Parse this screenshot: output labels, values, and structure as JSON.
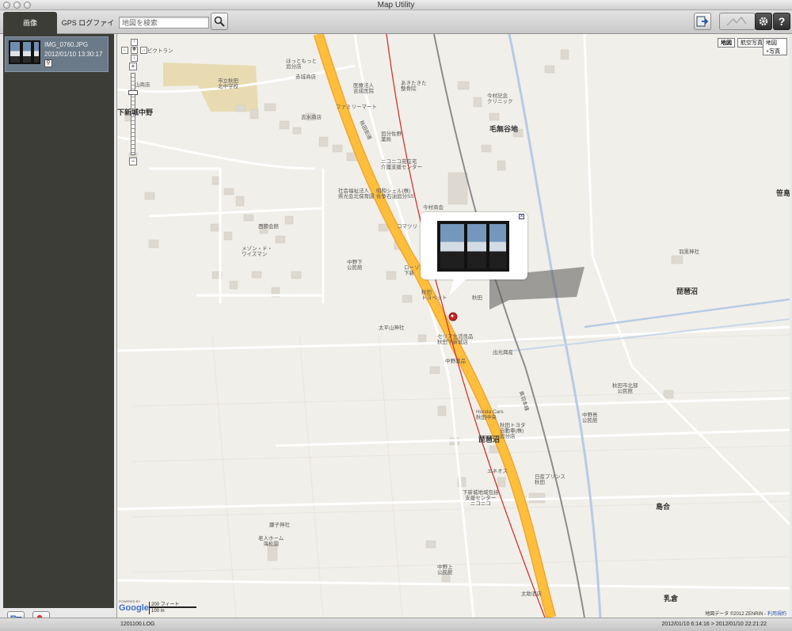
{
  "window": {
    "title": "Map Utility"
  },
  "tabs": {
    "images": "画像",
    "gps_log": "GPS ログファイル"
  },
  "search": {
    "placeholder": "地図を検索"
  },
  "sidebar": {
    "items": [
      {
        "filename": "IMG_0760.JPG",
        "datetime": "2012/01/10 13:30:17"
      }
    ]
  },
  "map": {
    "type_buttons": [
      "地図",
      "航空写真",
      "地図+写真"
    ],
    "labels": {
      "shokudo": "ビクトラン",
      "konan": "山商店",
      "school": "市立秋田\n北中学校",
      "hottomotto": "ほっともっと\n追分店",
      "akagi": "赤城商店",
      "iryou": "医療法人\n吉成医院",
      "akita_seikei": "あきたきた\n整骨院",
      "imamura": "今村記念\nクリニック",
      "familymart": "ファミリーマート",
      "yoshimizu": "吉水商店",
      "oiwake_yakkyoku": "追分佐野\n薬局",
      "nikoniko": "ニコニコ苑在宅\n介護支援センター",
      "shakai": "社会福祉法人\n県光会北保育園",
      "showa_shell": "昭和シェル(株)\n佐争石油追分SS",
      "komatsu": "コマツリ",
      "imaya": "今村商会",
      "nishiaikai": "西節会館",
      "mason": "メゾン・ド・\nワイズマン",
      "nakano_park": "中野下\n公民館",
      "lawson": "ローソン\n下新",
      "trolley": "秋田\nトヨペット",
      "akita_bank": "秋田",
      "taiheizan": "太平山神社",
      "seria": "セリア生活良品\n秋田下新城店",
      "kodemaru": "出光興産",
      "nakano_park2": "中野薬品",
      "kitabu": "秋田市北部\n公民館",
      "honda": "Honda Cars\n秋田中央",
      "toyota": "秋田トヨタ\n自動車(株)\n追分店",
      "nakano_shima": "中野島\n公民館",
      "eneos": "エネオス",
      "nissan": "日産プリンス\n秋田",
      "shimo_shinjo": "下新城地域包括\n支援センター\nニコニコ",
      "hayama": "羽黒神社",
      "tsutsuji": "躑子神社",
      "rojin": "老人ホーム\n海松園",
      "nakano_park3": "中野上\n公民館",
      "taiju": "太助酒店",
      "route_label": "秋田街道",
      "railway_label": "奥羽本線"
    },
    "places": {
      "shimoshinjo_nakano": "下新城中野",
      "kenashiyachi": "毛無谷地",
      "biwanuma": "琵琶沼",
      "biwanuma2": "琵琶沼",
      "tomashima": "笹島",
      "shimaai": "島合",
      "chikura": "乳倉"
    },
    "scale": {
      "feet": "200 フィート",
      "meters": "100 m"
    },
    "copyright": "地図データ ©2012 ZENRIN - ",
    "terms": "利用規約",
    "powered_by": "POWERED BY",
    "google": "Google"
  },
  "statusbar": {
    "log_file": "1201100.LOG",
    "time_range": "2012/01/10 6:14:16 > 2012/01/10 22:21:22"
  }
}
